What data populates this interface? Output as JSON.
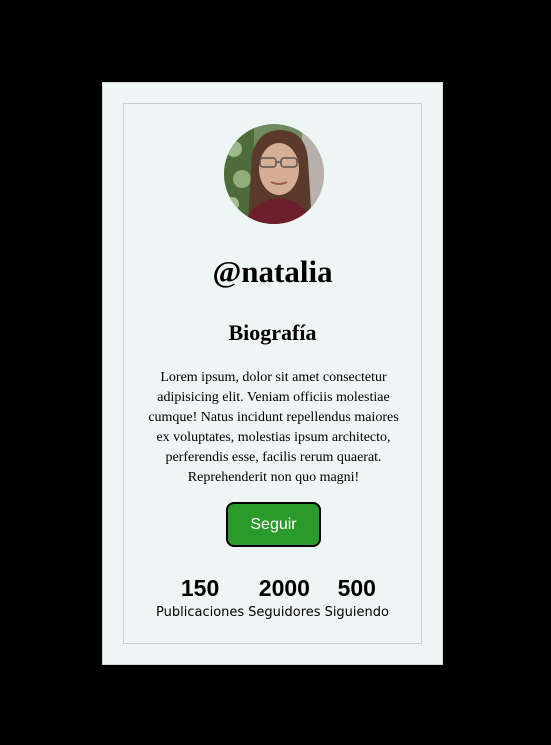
{
  "profile": {
    "username": "@natalia",
    "avatar_alt": "profile-photo",
    "bio_title": "Biografía",
    "bio_text": "Lorem ipsum, dolor sit amet consectetur adipisicing elit. Veniam officiis molestiae cumque! Natus incidunt repellendus maiores ex voluptates, molestias ipsum architecto, perferendis esse, facilis rerum quaerat. Reprehenderit non quo magni!",
    "follow_label": "Seguir"
  },
  "stats": [
    {
      "value": "150",
      "label": "Publicaciones"
    },
    {
      "value": "2000",
      "label": "Seguidores"
    },
    {
      "value": "500",
      "label": "Siguiendo"
    }
  ],
  "colors": {
    "background": "#000000",
    "card": "#eef5f5",
    "button": "#2a9a2a",
    "button_text": "#ffffff"
  }
}
